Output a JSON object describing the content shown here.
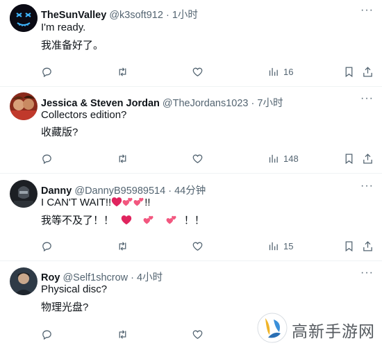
{
  "tweets": [
    {
      "display_name": "TheSunValley",
      "handle": "@k3soft912",
      "separator": "·",
      "time": "1小时",
      "lines": [
        "I'm ready.",
        "我准备好了。"
      ],
      "views": "16",
      "more_icon": "more-dots-icon"
    },
    {
      "display_name": "Jessica & Steven Jordan",
      "handle": "@TheJordans1023",
      "separator": "·",
      "time": "7小时",
      "lines": [
        "Collectors edition?",
        "收藏版?"
      ],
      "views": "148",
      "more_icon": "more-dots-icon"
    },
    {
      "display_name": "Danny",
      "handle": "@DannyB95989514",
      "separator": "·",
      "time": "44分钟",
      "line1_a": "I CAN'T WAIT!!",
      "line1_b": "!!",
      "line2_a": "我等不及了！！",
      "line2_b": "！！",
      "views": "15",
      "more_icon": "more-dots-icon"
    },
    {
      "display_name": "Roy",
      "handle": "@Self1shcrow",
      "separator": "·",
      "time": "4小时",
      "lines": [
        "Physical disc?",
        "物理光盘?"
      ],
      "more_icon": "more-dots-icon"
    }
  ],
  "actions": {
    "icons": [
      "reply-icon",
      "retweet-icon",
      "like-icon",
      "views-icon",
      "bookmark-icon",
      "share-icon"
    ]
  },
  "watermark": {
    "text": "高新手游网"
  },
  "colors": {
    "text": "#0f1419",
    "muted": "#536471",
    "border": "#eff3f4",
    "heart": "#e0245e"
  }
}
